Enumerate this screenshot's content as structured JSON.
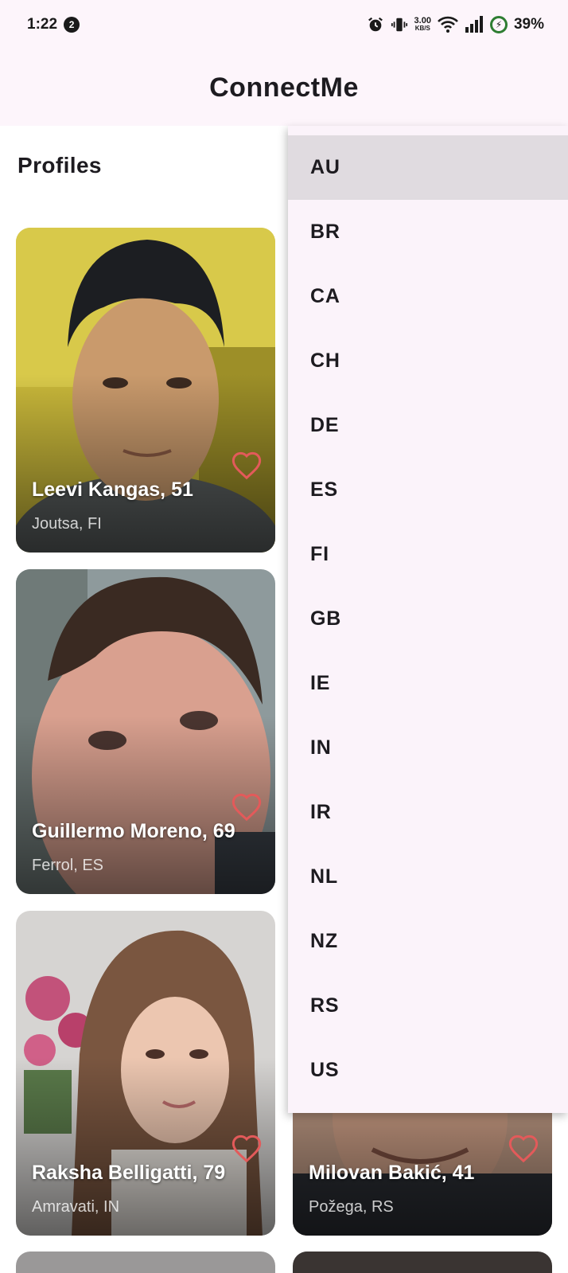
{
  "status_bar": {
    "time": "1:22",
    "notification_count": "2",
    "net_speed_value": "3.00",
    "net_speed_unit": "KB/S",
    "battery": "39%"
  },
  "app_bar": {
    "title": "ConnectMe"
  },
  "section": {
    "title": "Profiles"
  },
  "profiles": [
    {
      "name": "Leevi Kangas, 51",
      "location": "Joutsa, FI"
    },
    {
      "name": "Guillermo Moreno, 69",
      "location": "Ferrol, ES"
    },
    {
      "name": "Raksha Belligatti, 79",
      "location": "Amravati, IN"
    },
    {
      "name": "Milovan Bakić, 41",
      "location": "Požega, RS"
    }
  ],
  "country_menu": {
    "selected": "AU",
    "items": [
      "AU",
      "BR",
      "CA",
      "CH",
      "DE",
      "ES",
      "FI",
      "GB",
      "IE",
      "IN",
      "IR",
      "NL",
      "NZ",
      "RS",
      "US"
    ]
  },
  "colors": {
    "app_bar_bg": "#fdf5fb",
    "menu_bg": "#fbf3fa",
    "menu_selected_bg": "#e0dbe0",
    "heart": "#e35a5a"
  },
  "icons": [
    "alarm-icon",
    "vibrate-icon",
    "wifi-icon",
    "signal-icon",
    "battery-charging-icon",
    "heart-outline-icon"
  ]
}
